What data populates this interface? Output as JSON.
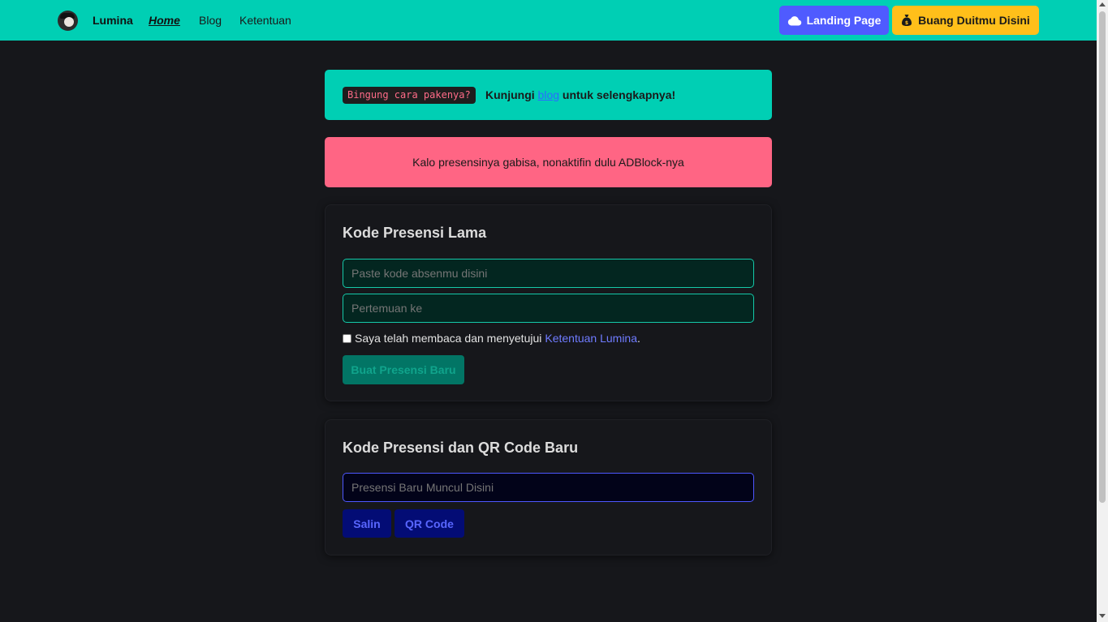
{
  "navbar": {
    "brand": "Lumina",
    "links": {
      "home": "Home",
      "blog": "Blog",
      "terms": "Ketentuan"
    },
    "landing_button": "Landing Page",
    "donate_button": "Buang Duitmu Disini",
    "landing_icon": "cloud-icon",
    "donate_icon": "money-bag-icon",
    "colors": {
      "bar": "#00cfb4",
      "landing": "#4f5bff",
      "donate": "#ffbf1a"
    }
  },
  "alerts": {
    "info": {
      "badge": "Bingung cara pakenya?",
      "text_before": "Kunjungi",
      "link": "blog",
      "text_after": "untuk selengkapnya!"
    },
    "warning": "Kalo presensinya gabisa, nonaktifin dulu ADBlock-nya"
  },
  "old_code_card": {
    "title": "Kode Presensi Lama",
    "code_placeholder": "Paste kode absenmu disini",
    "meeting_placeholder": "Pertemuan ke",
    "agree_text": "Saya telah membaca dan menyetujui",
    "agree_link": "Ketentuan Lumina",
    "agree_suffix": ".",
    "agreed": false,
    "submit_button": "Buat Presensi Baru"
  },
  "new_code_card": {
    "title": "Kode Presensi dan QR Code Baru",
    "output_placeholder": "Presensi Baru Muncul Disini",
    "copy_button": "Salin",
    "qr_button": "QR Code"
  }
}
